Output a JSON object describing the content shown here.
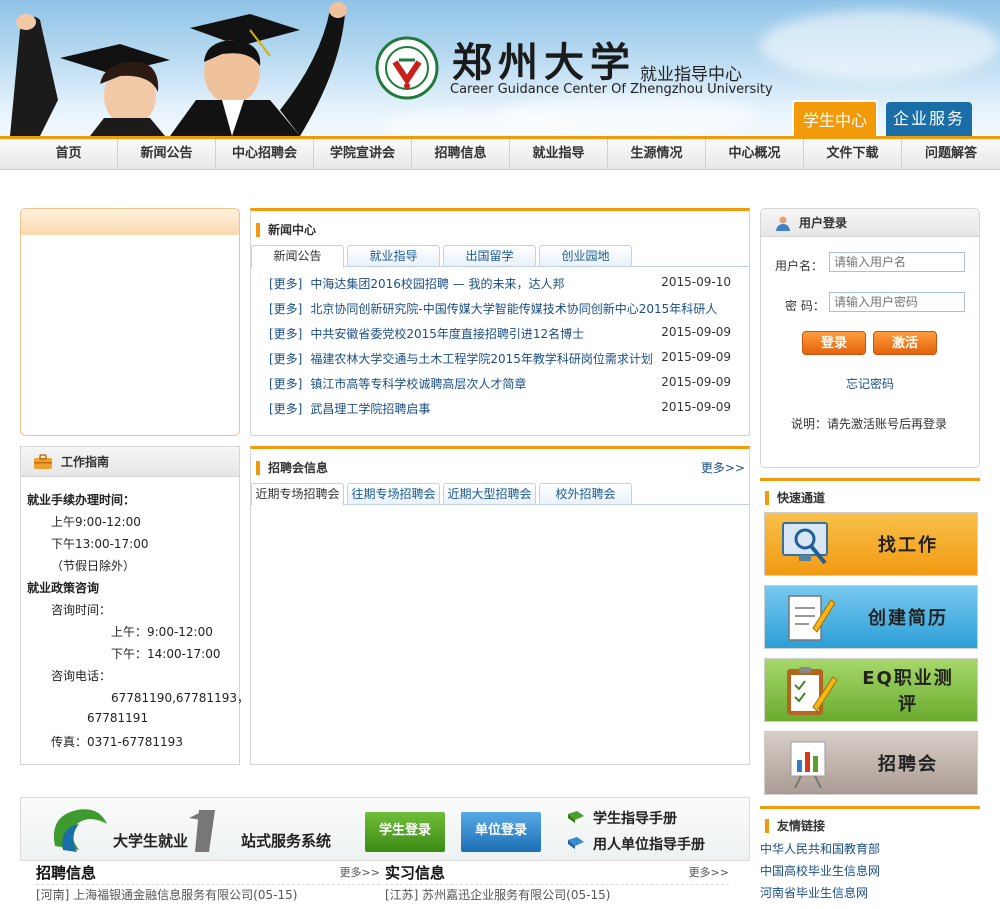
{
  "header": {
    "school_name": "郑州大学",
    "center_name": "就业指导中心",
    "center_name_en": "Career Guidance Center Of Zhengzhou University",
    "tab_student": "学生中心",
    "tab_company": "企业服务",
    "accent": "#f39a0a",
    "brand_blue": "#1a6ea8"
  },
  "nav": {
    "items": [
      "首页",
      "新闻公告",
      "中心招聘会",
      "学院宣讲会",
      "招聘信息",
      "就业指导",
      "生源情况",
      "中心概况",
      "文件下载",
      "问题解答"
    ]
  },
  "guide": {
    "title": "工作指南",
    "lines": [
      "就业手续办理时间：",
      "上午9:00-12:00",
      "下午13:00-17:00",
      "（节假日除外）",
      "就业政策咨询",
      "咨询时间：",
      "上午：9:00-12:00",
      "下午：14:00-17:00",
      "咨询电话：",
      "67781190,67781193，",
      "67781191",
      "传真：0371-67781193"
    ]
  },
  "news": {
    "title": "新闻中心",
    "tabs": [
      "新闻公告",
      "就业指导",
      "出国留学",
      "创业园地"
    ],
    "more_tag": "[更多]",
    "items": [
      {
        "text": "中海达集团2016校园招聘 — 我的未来，达人邦",
        "date": "2015-09-10"
      },
      {
        "text": "北京协同创新研究院-中国传媒大学智能传媒技术协同创新中心2015年科研人",
        "date": ""
      },
      {
        "text": "中共安徽省委党校2015年度直接招聘引进12名博士",
        "date": "2015-09-09"
      },
      {
        "text": "福建农林大学交通与土木工程学院2015年教学科研岗位需求计划",
        "date": "2015-09-09"
      },
      {
        "text": "镇江市高等专科学校诚聘高层次人才简章",
        "date": "2015-09-09"
      },
      {
        "text": "武昌理工学院招聘启事",
        "date": "2015-09-09"
      }
    ]
  },
  "fair": {
    "title": "招聘会信息",
    "more": "更多>>",
    "tabs": [
      "近期专场招聘会",
      "往期专场招聘会",
      "近期大型招聘会",
      "校外招聘会"
    ]
  },
  "login": {
    "title": "用户登录",
    "username_label": "用户名：",
    "username_placeholder": "请输入用户名",
    "password_label": "密 码：",
    "password_placeholder": "请输入用户密码",
    "login_button": "登录",
    "activate_button": "激活",
    "forgot": "忘记密码",
    "note": "说明：请先激活账号后再登录"
  },
  "quick": {
    "title": "快速通道",
    "items": [
      {
        "label": "找工作",
        "icon": "monitor-search-icon",
        "color": "#f2a41f"
      },
      {
        "label": "创建简历",
        "icon": "resume-pencil-icon",
        "color": "#3aa9de"
      },
      {
        "label": "EQ职业测评",
        "icon": "clipboard-check-icon",
        "color": "#7cbd3b"
      },
      {
        "label": "招聘会",
        "icon": "chart-board-icon",
        "color": "#b9aaa2"
      }
    ]
  },
  "links": {
    "title": "友情链接",
    "items": [
      "中华人民共和国教育部",
      "中国高校毕业生信息网",
      "河南省毕业生信息网"
    ]
  },
  "banner": {
    "brand_a": "大学生就业",
    "brand_b": "站式服务系统",
    "student_login": "学生登录",
    "company_login": "单位登录",
    "manual_student": "学生指导手册",
    "manual_company": "用人单位指导手册"
  },
  "recruit": {
    "title": "招聘信息",
    "more": "更多>>",
    "first": "[河南] 上海福银通金融信息服务有限公司(05-15)"
  },
  "intern": {
    "title": "实习信息",
    "more": "更多>>",
    "first": "[江苏] 苏州嘉迅企业服务有限公司(05-15)"
  }
}
